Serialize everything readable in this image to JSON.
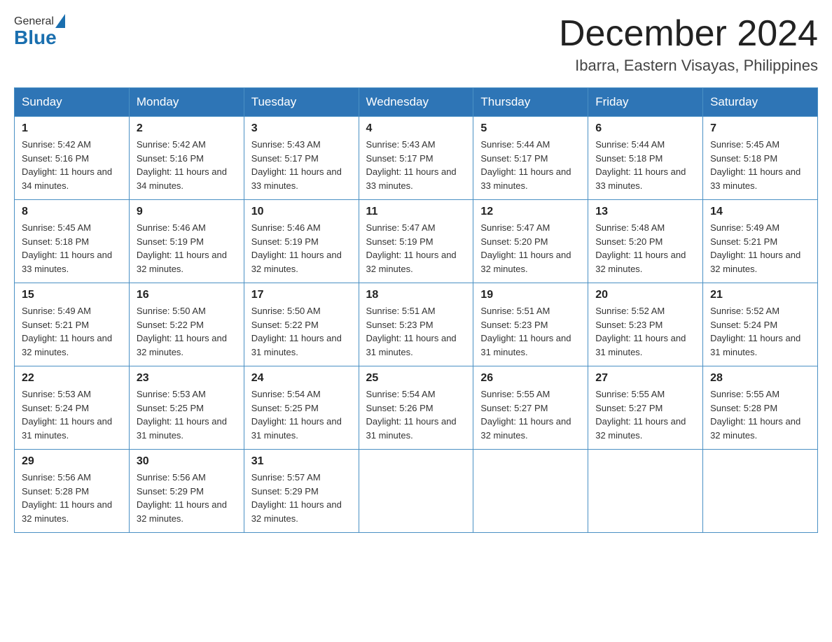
{
  "header": {
    "logo_line1": "General",
    "logo_line2": "Blue",
    "month_title": "December 2024",
    "location": "Ibarra, Eastern Visayas, Philippines"
  },
  "days_of_week": [
    "Sunday",
    "Monday",
    "Tuesday",
    "Wednesday",
    "Thursday",
    "Friday",
    "Saturday"
  ],
  "weeks": [
    [
      {
        "day": "1",
        "sunrise": "5:42 AM",
        "sunset": "5:16 PM",
        "daylight": "11 hours and 34 minutes."
      },
      {
        "day": "2",
        "sunrise": "5:42 AM",
        "sunset": "5:16 PM",
        "daylight": "11 hours and 34 minutes."
      },
      {
        "day": "3",
        "sunrise": "5:43 AM",
        "sunset": "5:17 PM",
        "daylight": "11 hours and 33 minutes."
      },
      {
        "day": "4",
        "sunrise": "5:43 AM",
        "sunset": "5:17 PM",
        "daylight": "11 hours and 33 minutes."
      },
      {
        "day": "5",
        "sunrise": "5:44 AM",
        "sunset": "5:17 PM",
        "daylight": "11 hours and 33 minutes."
      },
      {
        "day": "6",
        "sunrise": "5:44 AM",
        "sunset": "5:18 PM",
        "daylight": "11 hours and 33 minutes."
      },
      {
        "day": "7",
        "sunrise": "5:45 AM",
        "sunset": "5:18 PM",
        "daylight": "11 hours and 33 minutes."
      }
    ],
    [
      {
        "day": "8",
        "sunrise": "5:45 AM",
        "sunset": "5:18 PM",
        "daylight": "11 hours and 33 minutes."
      },
      {
        "day": "9",
        "sunrise": "5:46 AM",
        "sunset": "5:19 PM",
        "daylight": "11 hours and 32 minutes."
      },
      {
        "day": "10",
        "sunrise": "5:46 AM",
        "sunset": "5:19 PM",
        "daylight": "11 hours and 32 minutes."
      },
      {
        "day": "11",
        "sunrise": "5:47 AM",
        "sunset": "5:19 PM",
        "daylight": "11 hours and 32 minutes."
      },
      {
        "day": "12",
        "sunrise": "5:47 AM",
        "sunset": "5:20 PM",
        "daylight": "11 hours and 32 minutes."
      },
      {
        "day": "13",
        "sunrise": "5:48 AM",
        "sunset": "5:20 PM",
        "daylight": "11 hours and 32 minutes."
      },
      {
        "day": "14",
        "sunrise": "5:49 AM",
        "sunset": "5:21 PM",
        "daylight": "11 hours and 32 minutes."
      }
    ],
    [
      {
        "day": "15",
        "sunrise": "5:49 AM",
        "sunset": "5:21 PM",
        "daylight": "11 hours and 32 minutes."
      },
      {
        "day": "16",
        "sunrise": "5:50 AM",
        "sunset": "5:22 PM",
        "daylight": "11 hours and 32 minutes."
      },
      {
        "day": "17",
        "sunrise": "5:50 AM",
        "sunset": "5:22 PM",
        "daylight": "11 hours and 31 minutes."
      },
      {
        "day": "18",
        "sunrise": "5:51 AM",
        "sunset": "5:23 PM",
        "daylight": "11 hours and 31 minutes."
      },
      {
        "day": "19",
        "sunrise": "5:51 AM",
        "sunset": "5:23 PM",
        "daylight": "11 hours and 31 minutes."
      },
      {
        "day": "20",
        "sunrise": "5:52 AM",
        "sunset": "5:23 PM",
        "daylight": "11 hours and 31 minutes."
      },
      {
        "day": "21",
        "sunrise": "5:52 AM",
        "sunset": "5:24 PM",
        "daylight": "11 hours and 31 minutes."
      }
    ],
    [
      {
        "day": "22",
        "sunrise": "5:53 AM",
        "sunset": "5:24 PM",
        "daylight": "11 hours and 31 minutes."
      },
      {
        "day": "23",
        "sunrise": "5:53 AM",
        "sunset": "5:25 PM",
        "daylight": "11 hours and 31 minutes."
      },
      {
        "day": "24",
        "sunrise": "5:54 AM",
        "sunset": "5:25 PM",
        "daylight": "11 hours and 31 minutes."
      },
      {
        "day": "25",
        "sunrise": "5:54 AM",
        "sunset": "5:26 PM",
        "daylight": "11 hours and 31 minutes."
      },
      {
        "day": "26",
        "sunrise": "5:55 AM",
        "sunset": "5:27 PM",
        "daylight": "11 hours and 32 minutes."
      },
      {
        "day": "27",
        "sunrise": "5:55 AM",
        "sunset": "5:27 PM",
        "daylight": "11 hours and 32 minutes."
      },
      {
        "day": "28",
        "sunrise": "5:55 AM",
        "sunset": "5:28 PM",
        "daylight": "11 hours and 32 minutes."
      }
    ],
    [
      {
        "day": "29",
        "sunrise": "5:56 AM",
        "sunset": "5:28 PM",
        "daylight": "11 hours and 32 minutes."
      },
      {
        "day": "30",
        "sunrise": "5:56 AM",
        "sunset": "5:29 PM",
        "daylight": "11 hours and 32 minutes."
      },
      {
        "day": "31",
        "sunrise": "5:57 AM",
        "sunset": "5:29 PM",
        "daylight": "11 hours and 32 minutes."
      },
      null,
      null,
      null,
      null
    ]
  ],
  "labels": {
    "sunrise": "Sunrise:",
    "sunset": "Sunset:",
    "daylight": "Daylight:"
  }
}
